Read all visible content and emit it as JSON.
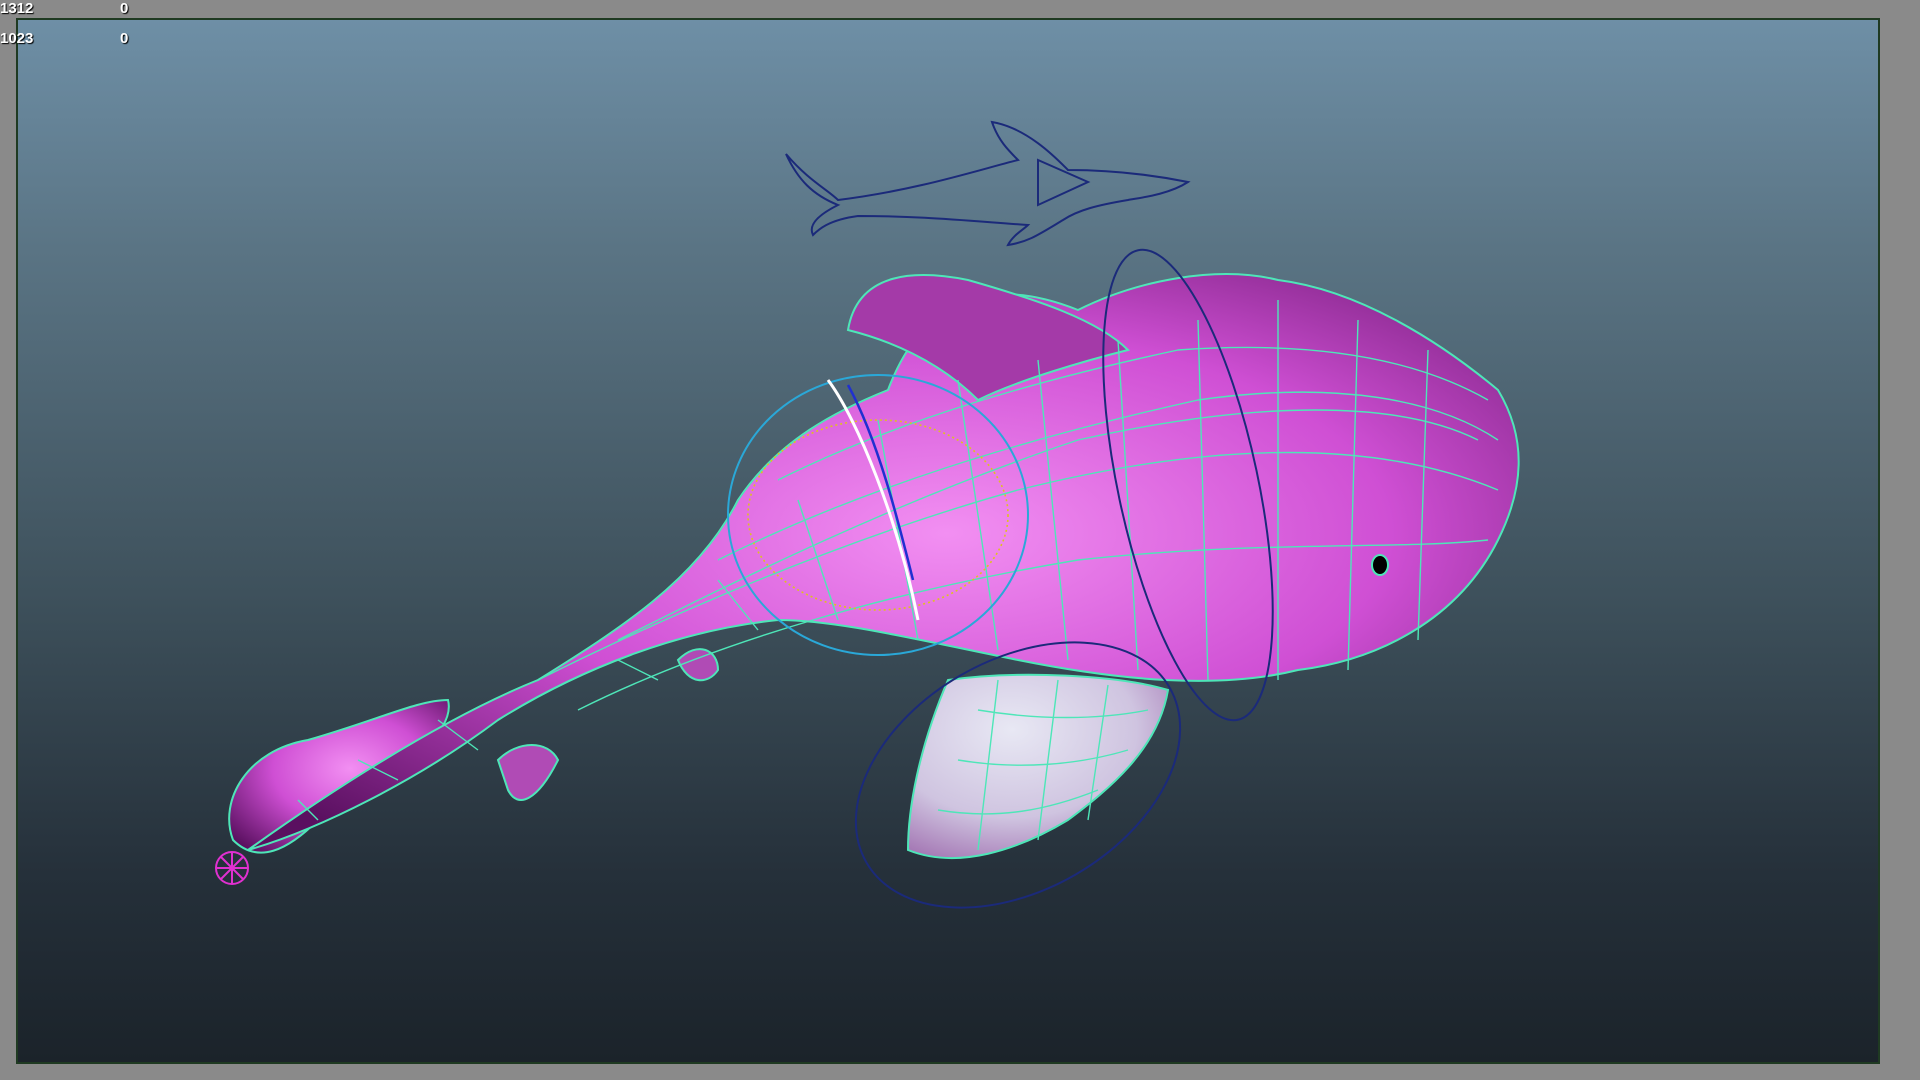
{
  "hud": {
    "rows": [
      {
        "label": "1312",
        "value": "0"
      },
      {
        "label": "1023",
        "value": "0"
      }
    ]
  },
  "colors": {
    "mesh": "#d44fd8",
    "wire": "#4ee6b8",
    "control": "#1b2a7a",
    "root": "#e030d0",
    "bg_top": "#6e8fa6",
    "bg_bottom": "#1b232a"
  },
  "icons": {
    "scene_object": "dolphin-model",
    "controller": "dolphin-outline-controller"
  }
}
